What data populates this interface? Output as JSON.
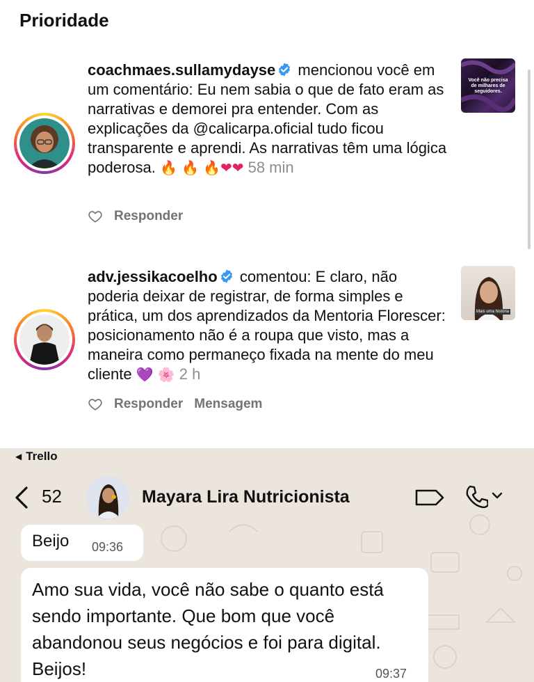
{
  "instagram": {
    "section_title": "Prioridade",
    "notifications": [
      {
        "username": "coachmaes.sullamydayse",
        "action_text": " mencionou você em um comentário: Eu nem sabia o que de fato eram as narrativas e demorei pra entender. Com as explicações da @calicarpa.oficial tudo ficou transparente e aprendi. As narrativas têm uma lógica poderosa. ",
        "emojis": [
          "🔥",
          "🔥",
          "🔥",
          "❤",
          "❤"
        ],
        "time": "58 min",
        "reply_label": "Responder",
        "thumbnail_text": "Você não precisa de milhares de seguidores."
      },
      {
        "username": "adv.jessikacoelho",
        "action_text": " comentou: E claro, não poderia deixar de registrar, de forma simples e prática, um dos aprendizados da Mentoria Florescer: posicionamento não é a roupa que visto, mas a maneira como permaneço fixada na mente do meu cliente ",
        "emojis": [
          "💜",
          "🌸"
        ],
        "time": "2 h",
        "reply_label": "Responder",
        "message_label": "Mensagem",
        "thumbnail_text": "Mais uma história"
      }
    ]
  },
  "whatsapp": {
    "status_back_label": "Trello",
    "unread_count": "52",
    "contact_name": "Mayara Lira Nutricionista",
    "messages": [
      {
        "text": "Beijo",
        "time": "09:36"
      },
      {
        "text": "Amo sua vida, você não sabe o quanto está sendo importante. Que bom que você abandonou seus negócios e foi para digital. Beijos!",
        "time": "09:37"
      }
    ]
  },
  "colors": {
    "verified_blue": "#3897f0",
    "muted_text": "#737373",
    "chat_background": "#ece5dd"
  },
  "icons": [
    "verified-badge-icon",
    "heart-outline-icon",
    "back-chevron-icon",
    "video-call-icon",
    "phone-icon",
    "chevron-down-icon"
  ]
}
